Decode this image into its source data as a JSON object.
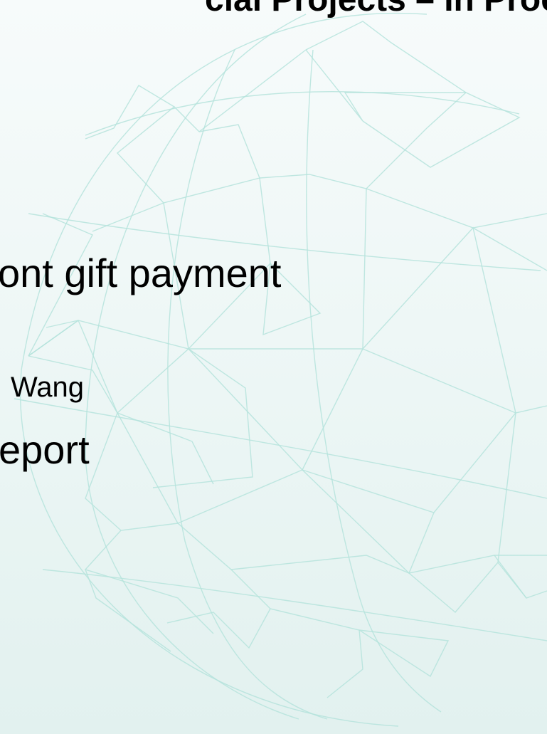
{
  "slide": {
    "title": "cial Projects – In Process",
    "lines": [
      "ont gift payment",
      "Wang",
      "eport"
    ]
  },
  "theme": {
    "background_top": "#f7fbfb",
    "background_bottom": "#e2f1ef",
    "globe_line_color": "#b5e3dc",
    "text_color": "#000000"
  }
}
